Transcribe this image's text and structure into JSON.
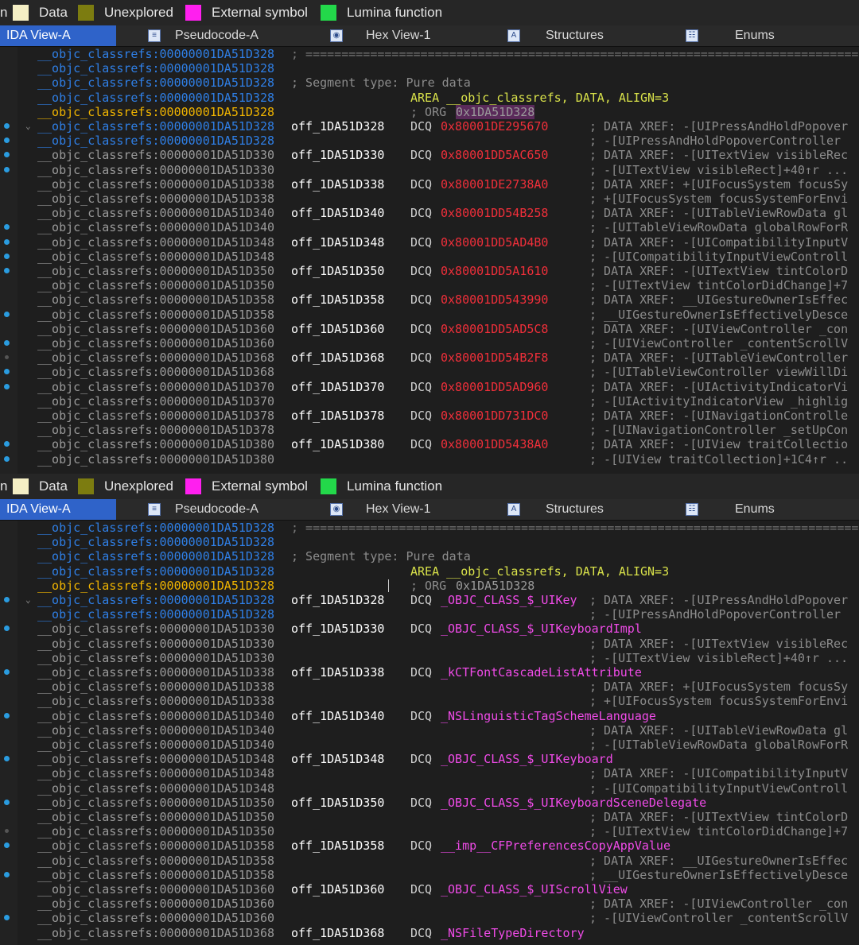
{
  "colors": {
    "legend_data": "#f5efc4",
    "legend_unexplored": "#7c7c10",
    "legend_external": "#ff1fef",
    "legend_lumina": "#23d84a",
    "active_tab": "#2f63c9",
    "addr_blue": "#2f7fe6",
    "addr_orange": "#f0b400",
    "value_red": "#f02f3a",
    "value_pink": "#f04be8"
  },
  "legend": {
    "cut_prefix": "n",
    "items": [
      {
        "label": "Data",
        "icon": "legend-data-swatch"
      },
      {
        "label": "Unexplored",
        "icon": "legend-unexplored-swatch"
      },
      {
        "label": "External symbol",
        "icon": "legend-external-swatch"
      },
      {
        "label": "Lumina function",
        "icon": "legend-lumina-swatch"
      }
    ]
  },
  "tabs": [
    {
      "label": "IDA View-A",
      "active": true,
      "icon": ""
    },
    {
      "label": "Pseudocode-A",
      "active": false,
      "icon": "pseudocode-icon"
    },
    {
      "label": "Hex View-1",
      "active": false,
      "icon": "hex-icon"
    },
    {
      "label": "Structures",
      "active": false,
      "icon": "structures-icon"
    },
    {
      "label": "Enums",
      "active": false,
      "icon": "enums-icon"
    }
  ],
  "common": {
    "addr": "__objc_classrefs:00000001DA51D328",
    "separator": "; =====================================================================================================",
    "segment_type": "; Segment type: Pure data",
    "area": "AREA __objc_classrefs, DATA, ALIGN=3",
    "org_prefix": "; ORG ",
    "org_value": "0x1DA51D328",
    "dcq": "DCQ"
  },
  "top_rows": [
    {
      "addr": "__objc_classrefs:00000001DA51D328",
      "label": "off_1DA51D328",
      "value": "0x80001DE295670",
      "comment": "; DATA XREF: -[UIPressAndHoldPopover",
      "dot": true,
      "chevron": true
    },
    {
      "addr": "__objc_classrefs:00000001DA51D328",
      "comment": "; -[UIPressAndHoldPopoverController",
      "dot": true
    },
    {
      "addr": "__objc_classrefs:00000001DA51D330",
      "label": "off_1DA51D330",
      "value": "0x80001DD5AC650",
      "comment": "; DATA XREF: -[UITextView visibleRec",
      "dot": true
    },
    {
      "addr": "__objc_classrefs:00000001DA51D330",
      "comment": "; -[UITextView visibleRect]+40↑r ...",
      "dot": true
    },
    {
      "addr": "__objc_classrefs:00000001DA51D338",
      "label": "off_1DA51D338",
      "value": "0x80001DE2738A0",
      "comment": "; DATA XREF: +[UIFocusSystem focusSy"
    },
    {
      "addr": "__objc_classrefs:00000001DA51D338",
      "comment": "; +[UIFocusSystem focusSystemForEnvi"
    },
    {
      "addr": "__objc_classrefs:00000001DA51D340",
      "label": "off_1DA51D340",
      "value": "0x80001DD54B258",
      "comment": "; DATA XREF: -[UITableViewRowData gl"
    },
    {
      "addr": "__objc_classrefs:00000001DA51D340",
      "comment": "; -[UITableViewRowData globalRowForR",
      "dot": true
    },
    {
      "addr": "__objc_classrefs:00000001DA51D348",
      "label": "off_1DA51D348",
      "value": "0x80001DD5AD4B0",
      "comment": "; DATA XREF: -[UICompatibilityInputV",
      "dot": true
    },
    {
      "addr": "__objc_classrefs:00000001DA51D348",
      "comment": "; -[UICompatibilityInputViewControll",
      "dot": true
    },
    {
      "addr": "__objc_classrefs:00000001DA51D350",
      "label": "off_1DA51D350",
      "value": "0x80001DD5A1610",
      "comment": "; DATA XREF: -[UITextView tintColorD",
      "dot": true
    },
    {
      "addr": "__objc_classrefs:00000001DA51D350",
      "comment": "; -[UITextView tintColorDidChange]+7"
    },
    {
      "addr": "__objc_classrefs:00000001DA51D358",
      "label": "off_1DA51D358",
      "value": "0x80001DD543990",
      "comment": "; DATA XREF: __UIGestureOwnerIsEffec"
    },
    {
      "addr": "__objc_classrefs:00000001DA51D358",
      "comment": "; __UIGestureOwnerIsEffectivelyDesce",
      "dot": true
    },
    {
      "addr": "__objc_classrefs:00000001DA51D360",
      "label": "off_1DA51D360",
      "value": "0x80001DD5AD5C8",
      "comment": "; DATA XREF: -[UIViewController _con"
    },
    {
      "addr": "__objc_classrefs:00000001DA51D360",
      "comment": "; -[UIViewController _contentScrollV",
      "dot": true
    },
    {
      "addr": "__objc_classrefs:00000001DA51D368",
      "label": "off_1DA51D368",
      "value": "0x80001DD54B2F8",
      "comment": "; DATA XREF: -[UITableViewController",
      "dot": true,
      "dot_gray": true
    },
    {
      "addr": "__objc_classrefs:00000001DA51D368",
      "comment": "; -[UITableViewController viewWillDi",
      "dot": true
    },
    {
      "addr": "__objc_classrefs:00000001DA51D370",
      "label": "off_1DA51D370",
      "value": "0x80001DD5AD960",
      "comment": "; DATA XREF: -[UIActivityIndicatorVi",
      "dot": true
    },
    {
      "addr": "__objc_classrefs:00000001DA51D370",
      "comment": "; -[UIActivityIndicatorView _highlig"
    },
    {
      "addr": "__objc_classrefs:00000001DA51D378",
      "label": "off_1DA51D378",
      "value": "0x80001DD731DC0",
      "comment": "; DATA XREF: -[UINavigationControlle"
    },
    {
      "addr": "__objc_classrefs:00000001DA51D378",
      "comment": "; -[UINavigationController _setUpCon"
    },
    {
      "addr": "__objc_classrefs:00000001DA51D380",
      "label": "off_1DA51D380",
      "value": "0x80001DD5438A0",
      "comment": "; DATA XREF: -[UIView traitCollectio",
      "dot": true
    },
    {
      "addr": "__objc_classrefs:00000001DA51D380",
      "comment": "; -[UIView traitCollection]+1C4↑r ..",
      "dot": true
    }
  ],
  "bottom_rows": [
    {
      "addr": "__objc_classrefs:00000001DA51D328",
      "label": "off_1DA51D328",
      "value": "_OBJC_CLASS_$_UIKey",
      "comment": "; DATA XREF: -[UIPressAndHoldPopover",
      "dot": true,
      "chevron": true
    },
    {
      "addr": "__objc_classrefs:00000001DA51D328",
      "comment": "; -[UIPressAndHoldPopoverController"
    },
    {
      "addr": "__objc_classrefs:00000001DA51D330",
      "label": "off_1DA51D330",
      "value": "_OBJC_CLASS_$_UIKeyboardImpl",
      "dot": true
    },
    {
      "addr": "__objc_classrefs:00000001DA51D330",
      "comment": "; DATA XREF: -[UITextView visibleRec"
    },
    {
      "addr": "__objc_classrefs:00000001DA51D330",
      "comment": "; -[UITextView visibleRect]+40↑r ..."
    },
    {
      "addr": "__objc_classrefs:00000001DA51D338",
      "label": "off_1DA51D338",
      "value": "_kCTFontCascadeListAttribute",
      "dot": true
    },
    {
      "addr": "__objc_classrefs:00000001DA51D338",
      "comment": "; DATA XREF: +[UIFocusSystem focusSy"
    },
    {
      "addr": "__objc_classrefs:00000001DA51D338",
      "comment": "; +[UIFocusSystem focusSystemForEnvi"
    },
    {
      "addr": "__objc_classrefs:00000001DA51D340",
      "label": "off_1DA51D340",
      "value": "_NSLinguisticTagSchemeLanguage",
      "dot": true
    },
    {
      "addr": "__objc_classrefs:00000001DA51D340",
      "comment": "; DATA XREF: -[UITableViewRowData gl"
    },
    {
      "addr": "__objc_classrefs:00000001DA51D340",
      "comment": "; -[UITableViewRowData globalRowForR"
    },
    {
      "addr": "__objc_classrefs:00000001DA51D348",
      "label": "off_1DA51D348",
      "value": "_OBJC_CLASS_$_UIKeyboard",
      "dot": true
    },
    {
      "addr": "__objc_classrefs:00000001DA51D348",
      "comment": "; DATA XREF: -[UICompatibilityInputV"
    },
    {
      "addr": "__objc_classrefs:00000001DA51D348",
      "comment": "; -[UICompatibilityInputViewControll"
    },
    {
      "addr": "__objc_classrefs:00000001DA51D350",
      "label": "off_1DA51D350",
      "value": "_OBJC_CLASS_$_UIKeyboardSceneDelegate",
      "dot": true
    },
    {
      "addr": "__objc_classrefs:00000001DA51D350",
      "comment": "; DATA XREF: -[UITextView tintColorD"
    },
    {
      "addr": "__objc_classrefs:00000001DA51D350",
      "comment": "; -[UITextView tintColorDidChange]+7",
      "dot": true,
      "dot_gray": true
    },
    {
      "addr": "__objc_classrefs:00000001DA51D358",
      "label": "off_1DA51D358",
      "value": "__imp__CFPreferencesCopyAppValue",
      "dot": true
    },
    {
      "addr": "__objc_classrefs:00000001DA51D358",
      "comment": "; DATA XREF: __UIGestureOwnerIsEffec"
    },
    {
      "addr": "__objc_classrefs:00000001DA51D358",
      "comment": "; __UIGestureOwnerIsEffectivelyDesce",
      "dot": true
    },
    {
      "addr": "__objc_classrefs:00000001DA51D360",
      "label": "off_1DA51D360",
      "value": "_OBJC_CLASS_$_UIScrollView"
    },
    {
      "addr": "__objc_classrefs:00000001DA51D360",
      "comment": "; DATA XREF: -[UIViewController _con"
    },
    {
      "addr": "__objc_classrefs:00000001DA51D360",
      "comment": "; -[UIViewController _contentScrollV",
      "dot": true
    },
    {
      "addr": "__objc_classrefs:00000001DA51D368",
      "label": "off_1DA51D368",
      "value": "_NSFileTypeDirectory"
    }
  ]
}
